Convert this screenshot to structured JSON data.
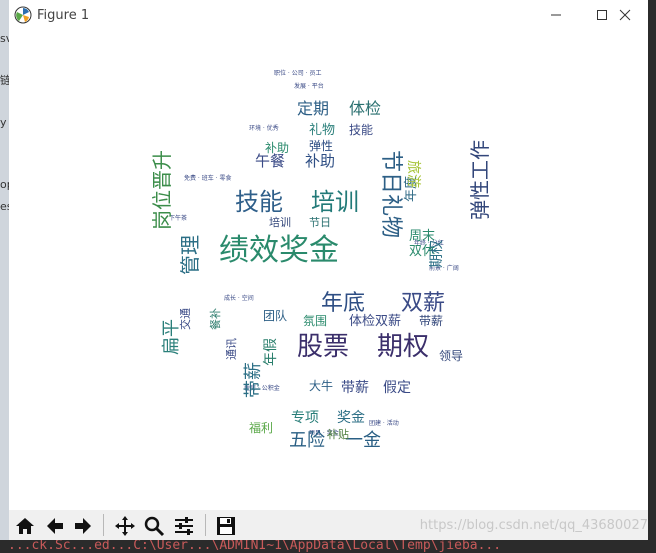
{
  "window": {
    "title": "Figure 1"
  },
  "background": {
    "left_fragments": [
      "sv",
      "链",
      "y",
      "op",
      "es"
    ],
    "bottom_text": "...ck.Sc...ed...C:\\User...\\ADMINI~1\\AppData\\Local\\Temp\\jieba..."
  },
  "toolbar": {
    "buttons": [
      "home",
      "back",
      "forward",
      "pan",
      "zoom",
      "configure",
      "save"
    ],
    "watermark": "https://blog.csdn.net/qq_43680027"
  },
  "colors": {
    "accent": "#1f77b4"
  },
  "wordcloud": {
    "words": [
      {
        "text": "绩效奖金",
        "color": "#2a8a6c"
      },
      {
        "text": "技能",
        "color": "#2f5f8a"
      },
      {
        "text": "培训",
        "color": "#227a78"
      },
      {
        "text": "股票",
        "color": "#3b2f6b"
      },
      {
        "text": "期权",
        "color": "#3b2f6b"
      },
      {
        "text": "年底",
        "color": "#2e4e84"
      },
      {
        "text": "双薪",
        "color": "#3a4a86"
      },
      {
        "text": "节日礼物",
        "color": "#2d5f86"
      },
      {
        "text": "岗位晋升",
        "color": "#3b8d4a"
      },
      {
        "text": "管理",
        "color": "#2c6f86"
      },
      {
        "text": "扁平",
        "color": "#2a7f7a"
      },
      {
        "text": "弹性工作",
        "color": "#32467a"
      },
      {
        "text": "定期",
        "color": "#2d5f86"
      },
      {
        "text": "体检",
        "color": "#2a7070"
      },
      {
        "text": "午餐",
        "color": "#3a4a86"
      },
      {
        "text": "补助",
        "color": "#2e4e84"
      },
      {
        "text": "五险",
        "color": "#2a5f84"
      },
      {
        "text": "一金",
        "color": "#2a5f84"
      },
      {
        "text": "带薪",
        "color": "#2c6f86"
      },
      {
        "text": "年假",
        "color": "#2a7f6c"
      },
      {
        "text": "周末",
        "color": "#2a8a6c"
      },
      {
        "text": "双休",
        "color": "#2a8a6c"
      },
      {
        "text": "餐补",
        "color": "#2e7d6e"
      },
      {
        "text": "交通",
        "color": "#3a4a86"
      },
      {
        "text": "通讯",
        "color": "#3a4a86"
      },
      {
        "text": "补贴",
        "color": "#4b7d3c"
      },
      {
        "text": "专项",
        "color": "#2a7f7a"
      },
      {
        "text": "奖金",
        "color": "#2c6f86"
      },
      {
        "text": "假定",
        "color": "#3a4a86"
      },
      {
        "text": "团队",
        "color": "#2d5f86"
      },
      {
        "text": "领导",
        "color": "#32467a"
      },
      {
        "text": "氛围",
        "color": "#2a8a6c"
      },
      {
        "text": "体检双薪",
        "color": "#3a4a86"
      },
      {
        "text": "带薪",
        "color": "#32467a"
      },
      {
        "text": "年度",
        "color": "#2f6a86"
      },
      {
        "text": "旅游",
        "color": "#a8c43a"
      },
      {
        "text": "礼物",
        "color": "#2a7f7a"
      },
      {
        "text": "技能",
        "color": "#3a4a86"
      },
      {
        "text": "弹性",
        "color": "#2e4e84"
      },
      {
        "text": "期权",
        "color": "#2c6f86"
      },
      {
        "text": "大牛",
        "color": "#2d5f86"
      },
      {
        "text": "带薪",
        "color": "#3a4a86"
      },
      {
        "text": "补助",
        "color": "#2a8a6c"
      },
      {
        "text": "培训",
        "color": "#32467a"
      },
      {
        "text": "节日",
        "color": "#2a7070"
      },
      {
        "text": "福利",
        "color": "#5aa848"
      }
    ]
  }
}
